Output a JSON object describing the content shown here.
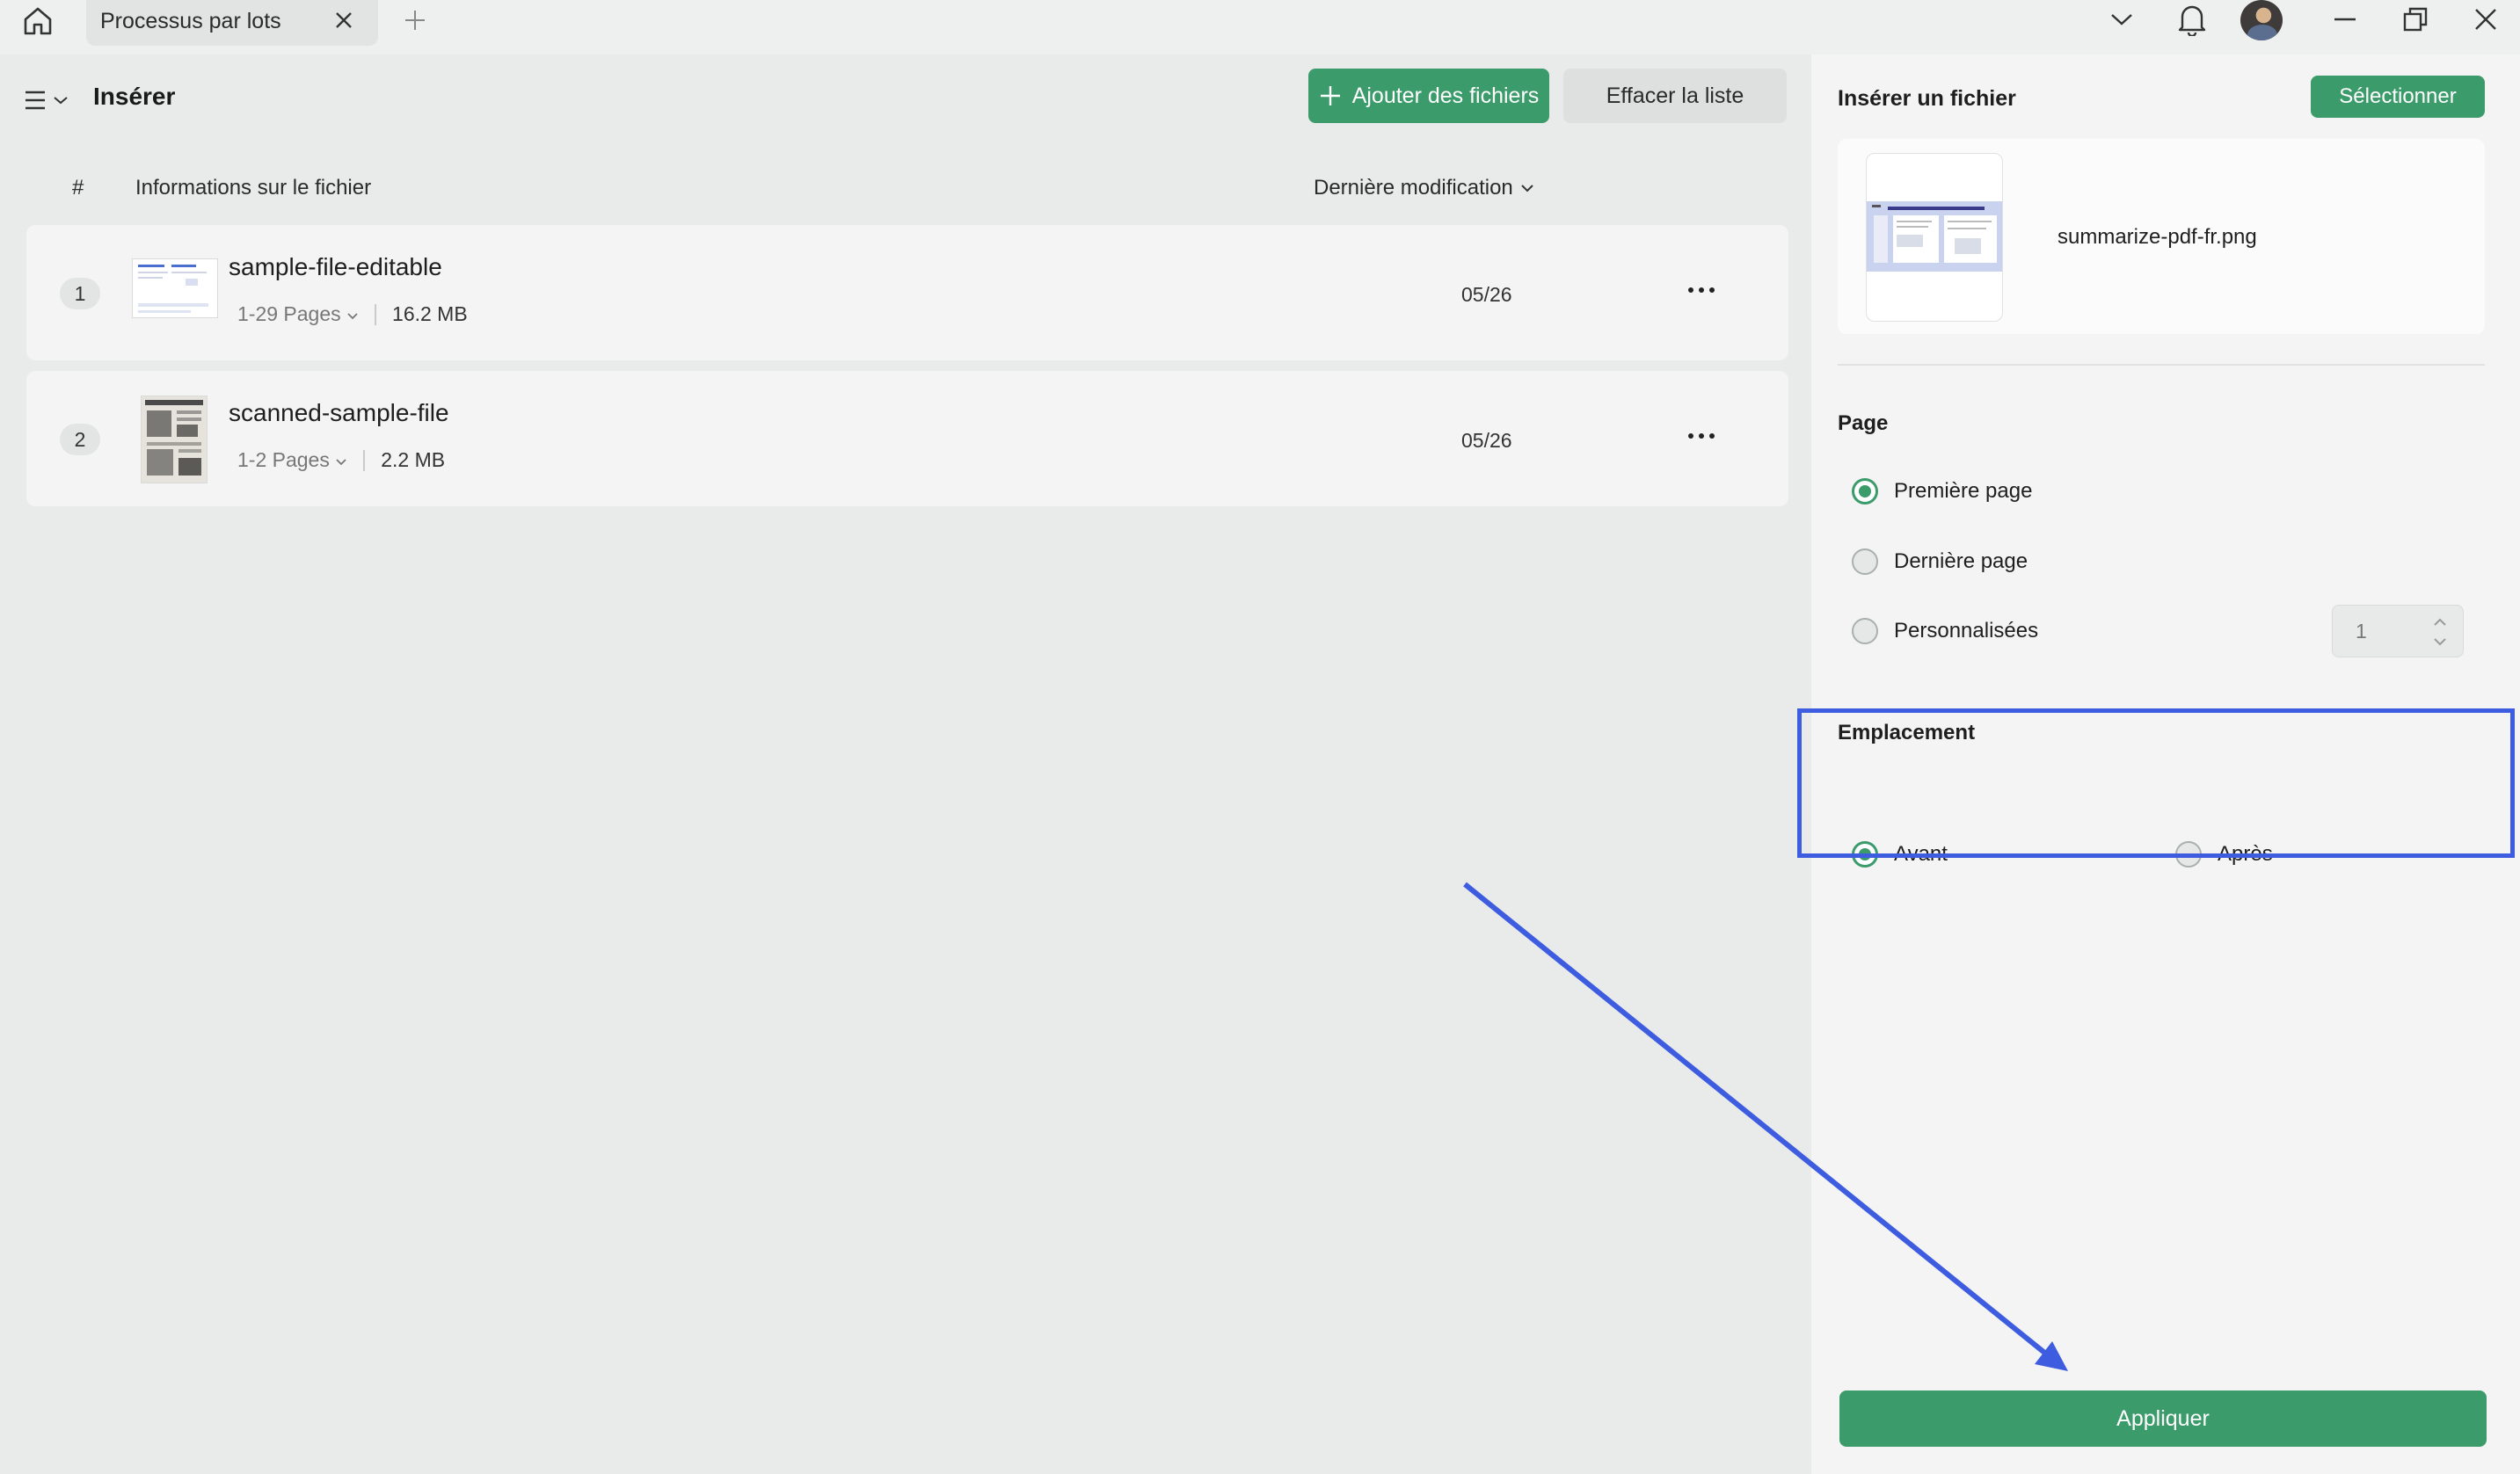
{
  "tab": {
    "title": "Processus par lots"
  },
  "left_panel": {
    "title": "Insérer",
    "add_files_label": "Ajouter des fichiers",
    "clear_list_label": "Effacer la liste",
    "columns": {
      "number": "#",
      "info": "Informations sur le fichier",
      "modified": "Dernière modification"
    },
    "files": [
      {
        "index": "1",
        "name": "sample-file-editable",
        "pages": "1-29 Pages",
        "size": "16.2 MB",
        "date": "05/26"
      },
      {
        "index": "2",
        "name": "scanned-sample-file",
        "pages": "1-2 Pages",
        "size": "2.2 MB",
        "date": "05/26"
      }
    ]
  },
  "right_panel": {
    "title": "Insérer un fichier",
    "select_label": "Sélectionner",
    "insert_file_name": "summarize-pdf-fr.png",
    "page_section": {
      "label": "Page",
      "options": [
        "Première page",
        "Dernière page",
        "Personnalisées"
      ],
      "selected": "Première page",
      "custom_value": "1"
    },
    "location_section": {
      "label": "Emplacement",
      "options": [
        "Avant",
        "Après"
      ],
      "selected": "Avant"
    },
    "apply_label": "Appliquer"
  },
  "colors": {
    "accent": "#3b9b6b",
    "annotation": "#3d5ce0"
  }
}
